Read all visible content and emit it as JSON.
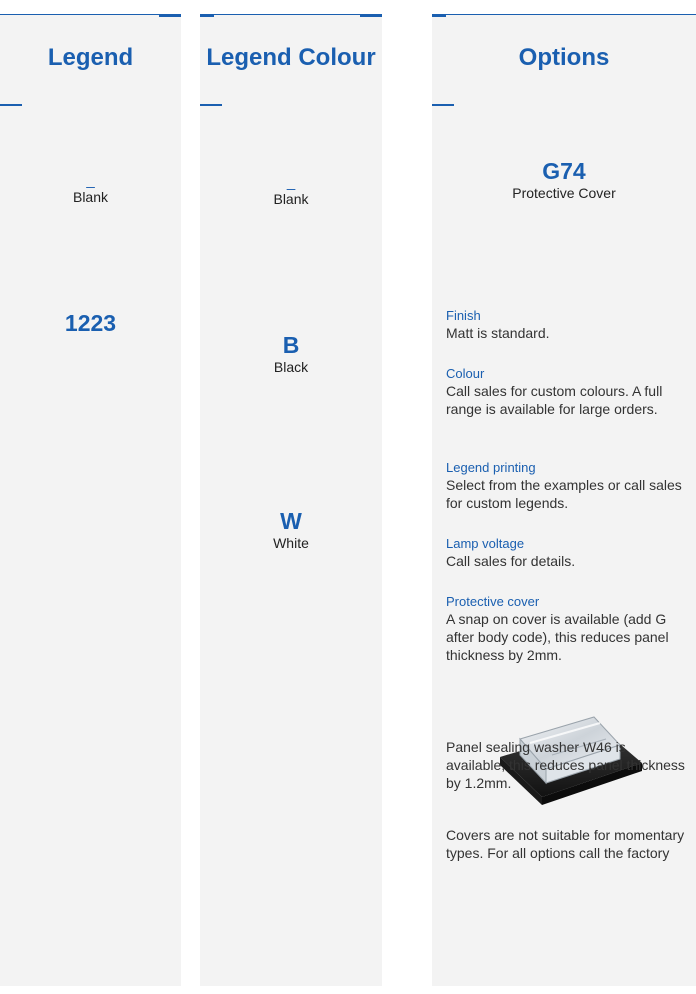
{
  "columns": {
    "legend": {
      "heading": "Legend",
      "items": [
        {
          "code": "_",
          "label": "Blank"
        },
        {
          "code": "1223",
          "label": ""
        }
      ]
    },
    "legend_colour": {
      "heading": "Legend Colour",
      "items": [
        {
          "code": "_",
          "label": "Blank"
        },
        {
          "code": "B",
          "label": "Black"
        },
        {
          "code": "W",
          "label": "White"
        }
      ]
    },
    "options": {
      "heading": "Options",
      "option_code": "G74",
      "option_label": "Protective Cover",
      "notes": [
        {
          "title": "Finish",
          "body": "Matt is standard."
        },
        {
          "title": "Colour",
          "body": "Call sales for custom colours. A full range is available for large orders."
        },
        {
          "title": "Legend printing",
          "body": "Select from the examples or call sales for custom legends."
        },
        {
          "title": "Lamp voltage",
          "body": "Call sales for details."
        },
        {
          "title": "Protective cover",
          "body": "A snap on cover is available (add G after body code), this reduces panel thickness by 2mm."
        }
      ],
      "sealing_note": "Panel sealing washer W46 is available, this reduces panel thickness by 1.2mm.",
      "covers_note": "Covers are not suitable for momentary types. For all options call the factory"
    }
  },
  "colors": {
    "accent": "#1a5fb0",
    "column_bg": "#f3f3f3"
  }
}
